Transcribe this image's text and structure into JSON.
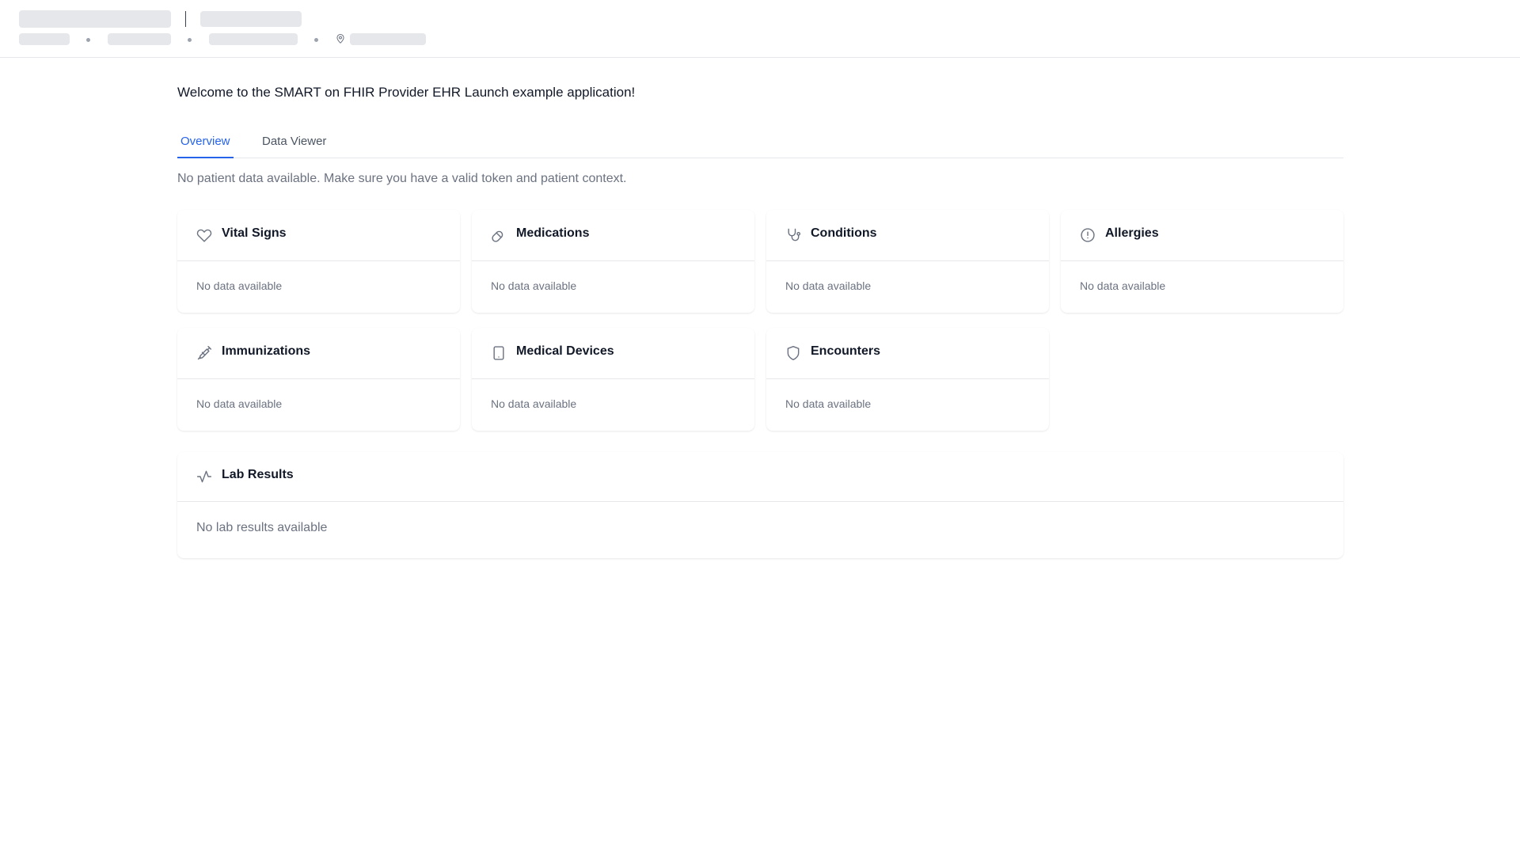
{
  "header": {
    "loading": true,
    "icons": [
      "map-pin-icon"
    ]
  },
  "welcome": "Welcome to the SMART on FHIR Provider EHR Launch example application!",
  "tabs": [
    {
      "label": "Overview",
      "active": true
    },
    {
      "label": "Data Viewer",
      "active": false
    }
  ],
  "no_patient_message": "No patient data available. Make sure you have a valid token and patient context.",
  "cards": [
    {
      "title": "Vital Signs",
      "icon": "heart-icon",
      "empty": "No data available"
    },
    {
      "title": "Medications",
      "icon": "pill-icon",
      "empty": "No data available"
    },
    {
      "title": "Conditions",
      "icon": "stethoscope-icon",
      "empty": "No data available"
    },
    {
      "title": "Allergies",
      "icon": "alert-circle-icon",
      "empty": "No data available"
    },
    {
      "title": "Immunizations",
      "icon": "syringe-icon",
      "empty": "No data available"
    },
    {
      "title": "Medical Devices",
      "icon": "tablet-icon",
      "empty": "No data available"
    },
    {
      "title": "Encounters",
      "icon": "shield-icon",
      "empty": "No data available"
    }
  ],
  "lab_results": {
    "title": "Lab Results",
    "icon": "activity-icon",
    "empty": "No lab results available"
  },
  "colors": {
    "accent": "#2563eb",
    "muted_text": "#6b7280",
    "skeleton": "#e5e7eb"
  }
}
